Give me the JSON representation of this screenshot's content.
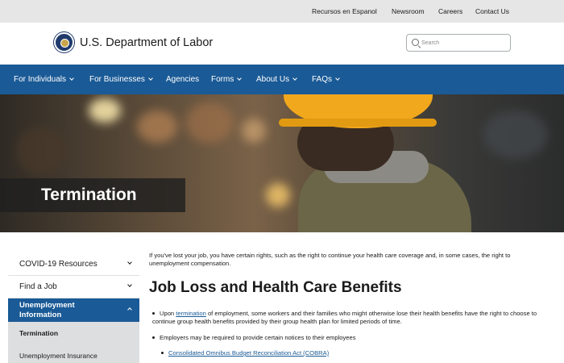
{
  "utility_nav": {
    "spanish": "Recursos en Espanol",
    "newsroom": "Newsroom",
    "careers": "Careers",
    "contact": "Contact Us"
  },
  "header": {
    "agency_name": "U.S. Department of Labor",
    "search_placeholder": "Search"
  },
  "main_nav": {
    "items": [
      {
        "label": "For Individuals",
        "has_dropdown": true
      },
      {
        "label": "For Businesses",
        "has_dropdown": true
      },
      {
        "label": "Agencies",
        "has_dropdown": false
      },
      {
        "label": "Forms",
        "has_dropdown": true
      },
      {
        "label": "About Us",
        "has_dropdown": true
      },
      {
        "label": "FAQs",
        "has_dropdown": true
      }
    ]
  },
  "hero": {
    "title": "Termination"
  },
  "sidebar": {
    "items": [
      {
        "label": "COVID-19 Resources"
      },
      {
        "label": "Find a Job"
      }
    ],
    "active_section": "Unemployment Information",
    "sub_items": [
      {
        "label": "Termination",
        "current": true
      },
      {
        "label": "Unemployment Insurance",
        "current": false
      }
    ]
  },
  "content": {
    "intro": "If you've lost your job, you have certain rights, such as the right to continue your health care coverage and, in some cases, the right to unemployment compensation.",
    "heading": "Job Loss and Health Care Benefits",
    "bullet1_prefix": "Upon ",
    "bullet1_link": "termination",
    "bullet1_suffix": " of employment, some workers and their families who might otherwise lose their health benefits have the right to choose to continue group health benefits provided by their group health plan for limited periods of time.",
    "bullet2": "Employers may be required to provide certain notices to their employees",
    "sub_bullet_link": "Consolidated Omnibus Budget Reconciliation Act (COBRA)"
  },
  "colors": {
    "primary_blue": "#1a5a96",
    "utility_gray": "#e6e6e6"
  }
}
